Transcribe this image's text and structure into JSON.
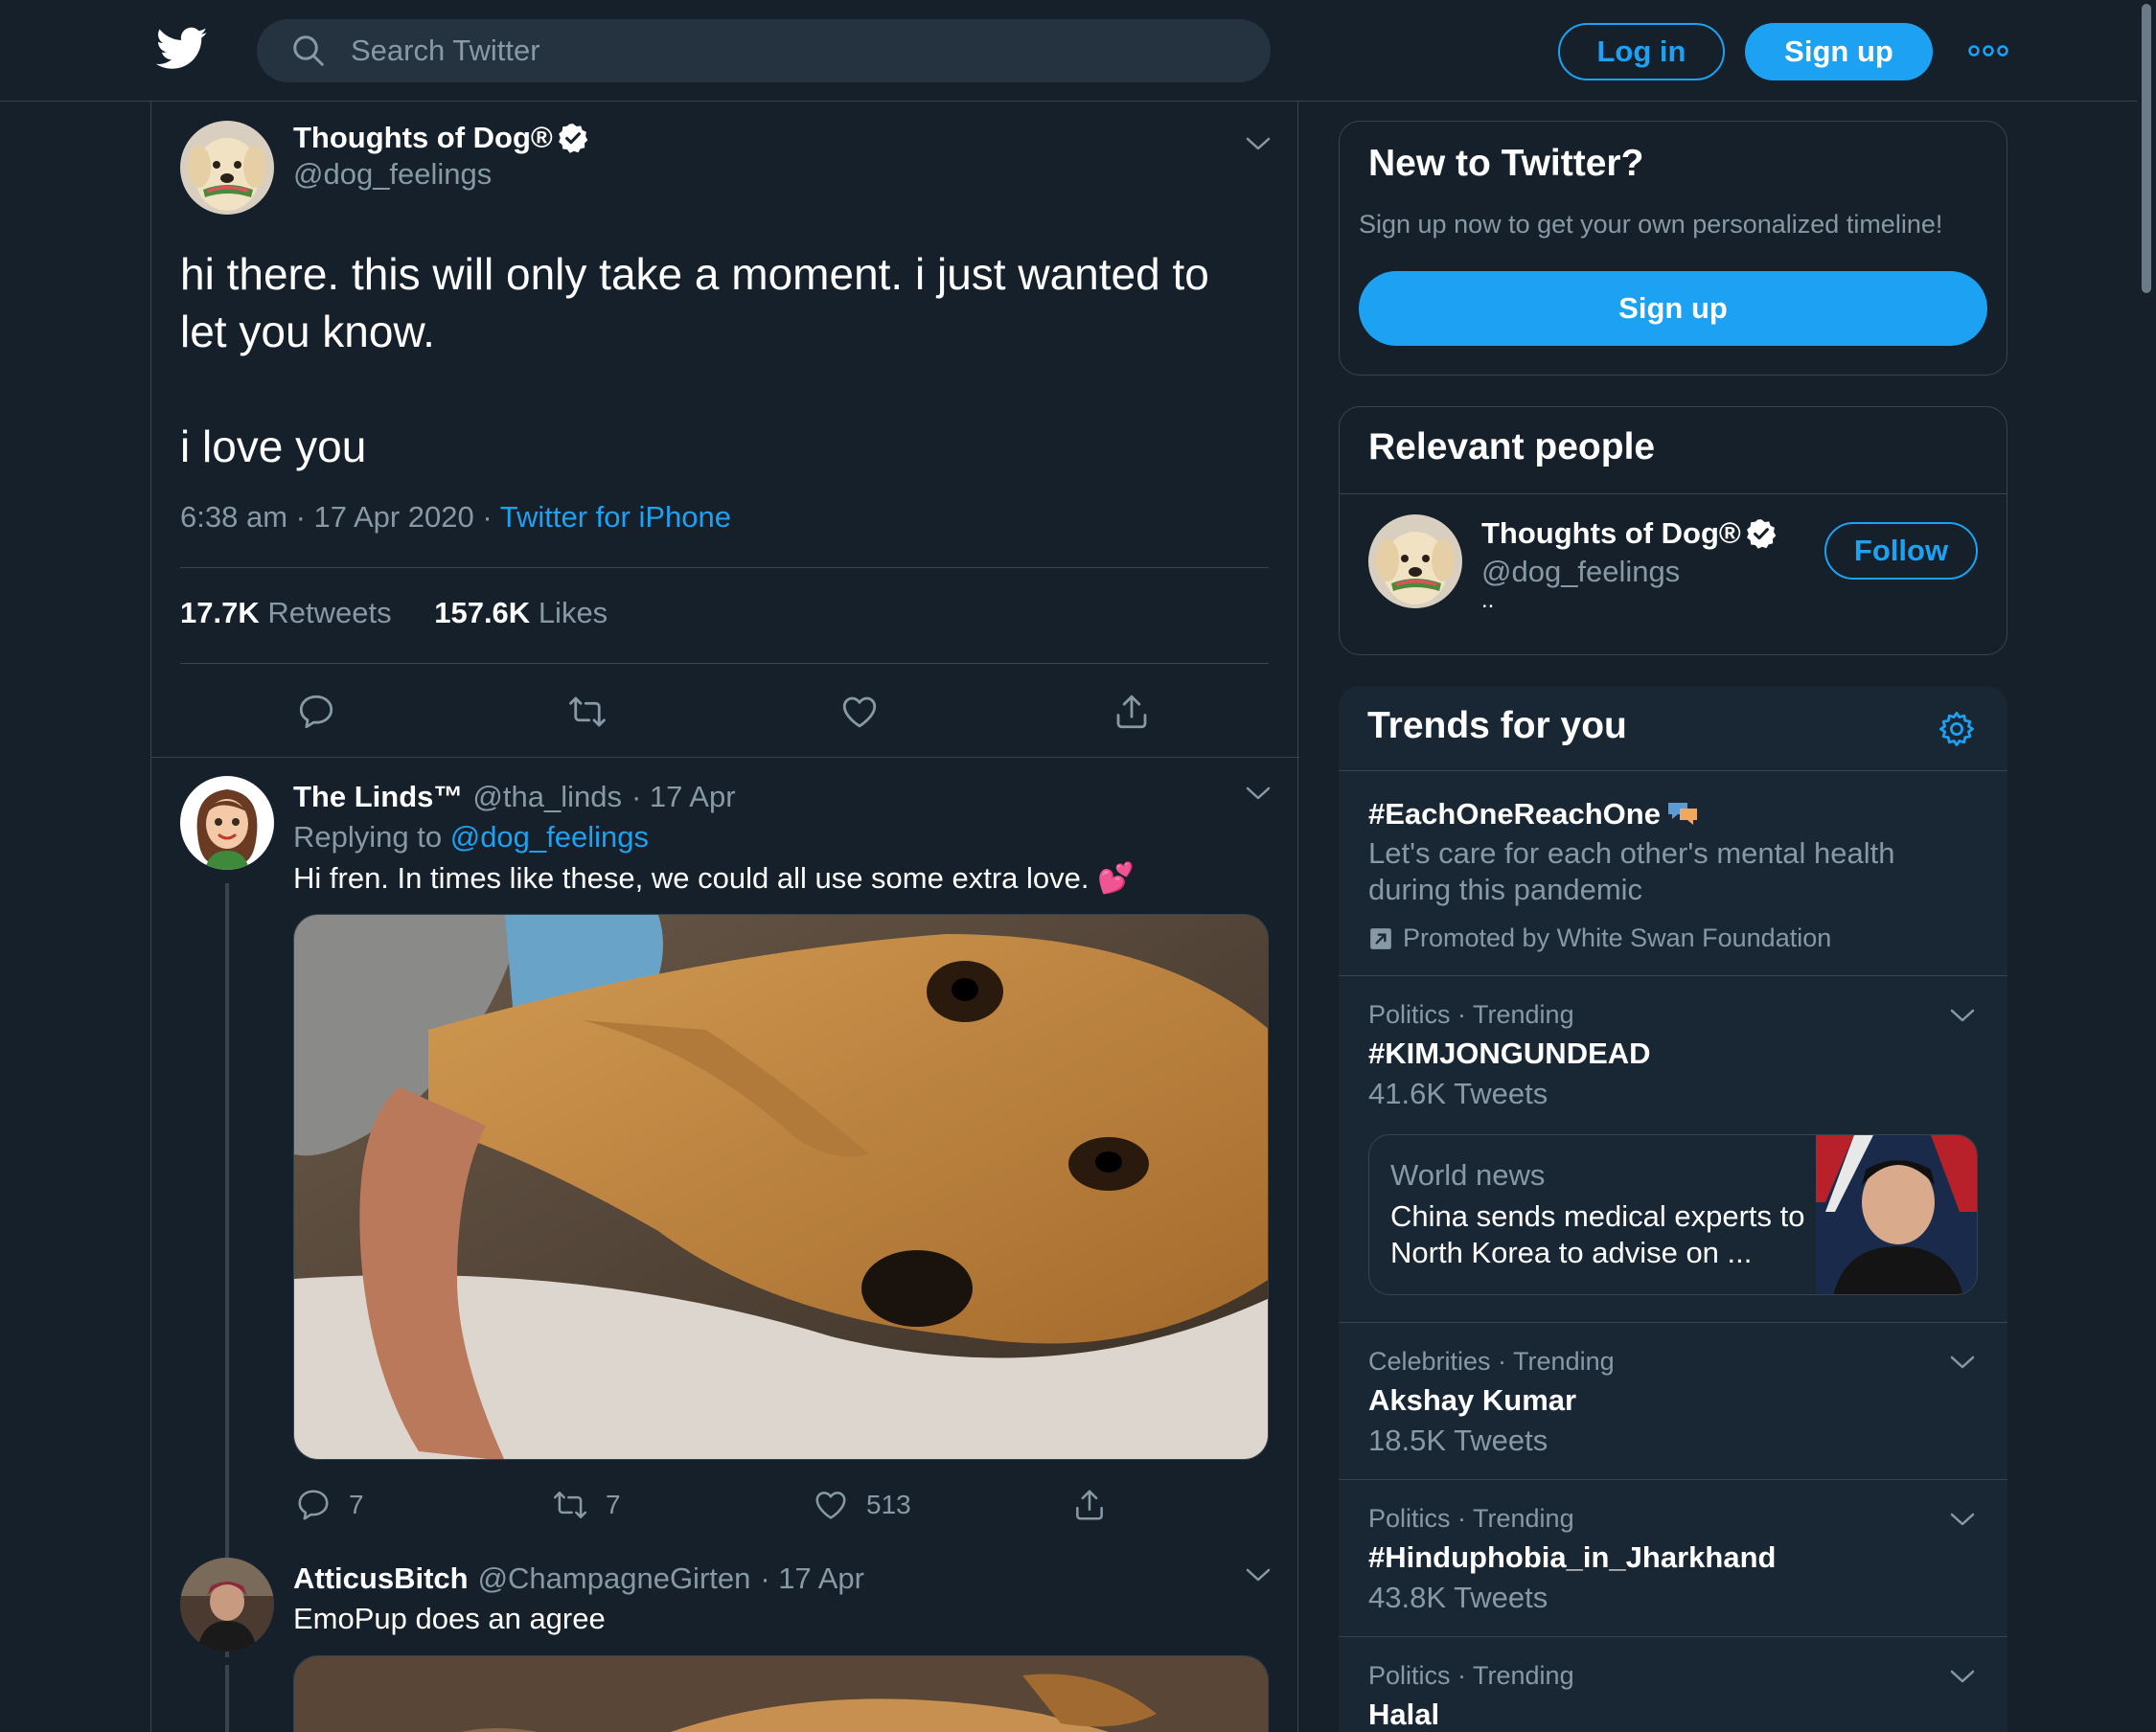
{
  "header": {
    "search_placeholder": "Search Twitter",
    "login_label": "Log in",
    "signup_label": "Sign up"
  },
  "tweet": {
    "author_name": "Thoughts of Dog®",
    "author_handle": "@dog_feelings",
    "text_line1": "hi there. this will only take a moment. i just wanted to let you know.",
    "text_line2": "i love you",
    "time": "6:38 am · 17 Apr 2020 · ",
    "source": "Twitter for iPhone",
    "retweets_count": "17.7K",
    "retweets_label": "Retweets",
    "likes_count": "157.6K",
    "likes_label": "Likes"
  },
  "replies": [
    {
      "name": "The Linds™",
      "handle": "@tha_linds",
      "date": "· 17 Apr",
      "replying_prefix": "Replying to",
      "replying_handle": "@dog_feelings",
      "text": "Hi fren. In times like these, we could all use some extra love. 💕",
      "reply_count": "7",
      "retweet_count": "7",
      "like_count": "513"
    },
    {
      "name": "AtticusBitch",
      "handle": "@ChampagneGirten",
      "date": "· 17 Apr",
      "text": "EmoPup does an agree"
    }
  ],
  "sidebar": {
    "new_to_twitter": {
      "title": "New to Twitter?",
      "subtitle": "Sign up now to get your own personalized timeline!",
      "button": "Sign up"
    },
    "relevant_people": {
      "title": "Relevant people",
      "name": "Thoughts of Dog®",
      "handle": "@dog_feelings",
      "bio": "..",
      "follow_label": "Follow"
    },
    "trends": {
      "title": "Trends for you",
      "promoted": {
        "title": "#EachOneReachOne",
        "description": "Let's care for each other's mental health during this pandemic",
        "promoted_by": "Promoted by White Swan Foundation"
      },
      "items": [
        {
          "category": "Politics · Trending",
          "title": "#KIMJONGUNDEAD",
          "count": "41.6K Tweets",
          "news_label": "World news",
          "news_title": "China sends medical experts to North Korea to advise on ..."
        },
        {
          "category": "Celebrities · Trending",
          "title": "Akshay Kumar",
          "count": "18.5K Tweets"
        },
        {
          "category": "Politics · Trending",
          "title": "#Hinduphobia_in_Jharkhand",
          "count": "43.8K Tweets"
        },
        {
          "category": "Politics · Trending",
          "title": "Halal"
        }
      ]
    }
  },
  "colors": {
    "background": "#15202b",
    "accent": "#1da1f2",
    "muted_text": "#8899a6",
    "border": "#38444d"
  }
}
